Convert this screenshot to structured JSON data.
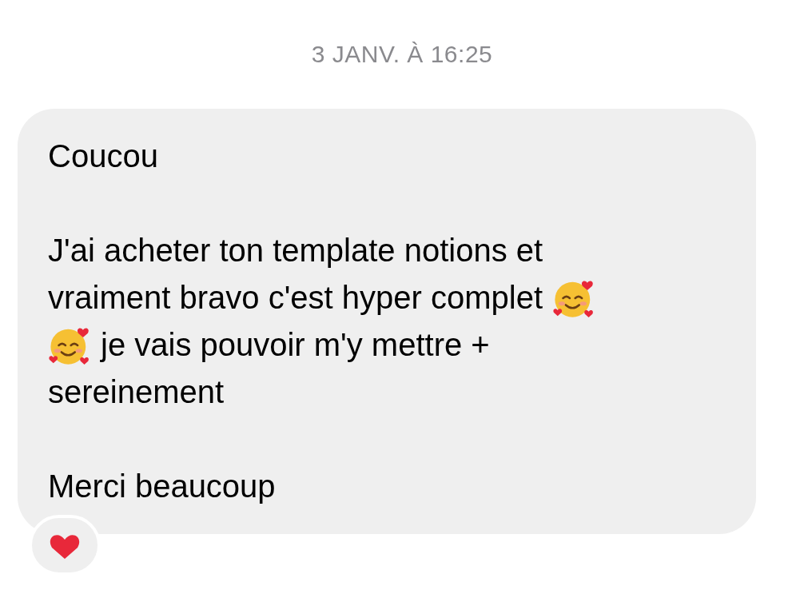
{
  "timestamp": "3 JANV. À 16:25",
  "message": {
    "paragraphs": [
      {
        "lines": [
          [
            {
              "kind": "text",
              "text": "Coucou"
            }
          ]
        ]
      },
      {
        "lines": [
          [
            {
              "kind": "text",
              "text": "J'ai acheter ton template notions et"
            }
          ],
          [
            {
              "kind": "text",
              "text": "vraiment bravo c'est hyper complet"
            },
            {
              "kind": "emoji"
            }
          ],
          [
            {
              "kind": "emoji"
            },
            {
              "kind": "text",
              "text": "je vais pouvoir m'y mettre +"
            }
          ],
          [
            {
              "kind": "text",
              "text": "sereinement"
            }
          ]
        ]
      },
      {
        "lines": [
          [
            {
              "kind": "text",
              "text": "Merci beaucoup"
            }
          ]
        ]
      }
    ]
  },
  "reaction": {
    "kind": "heart"
  }
}
